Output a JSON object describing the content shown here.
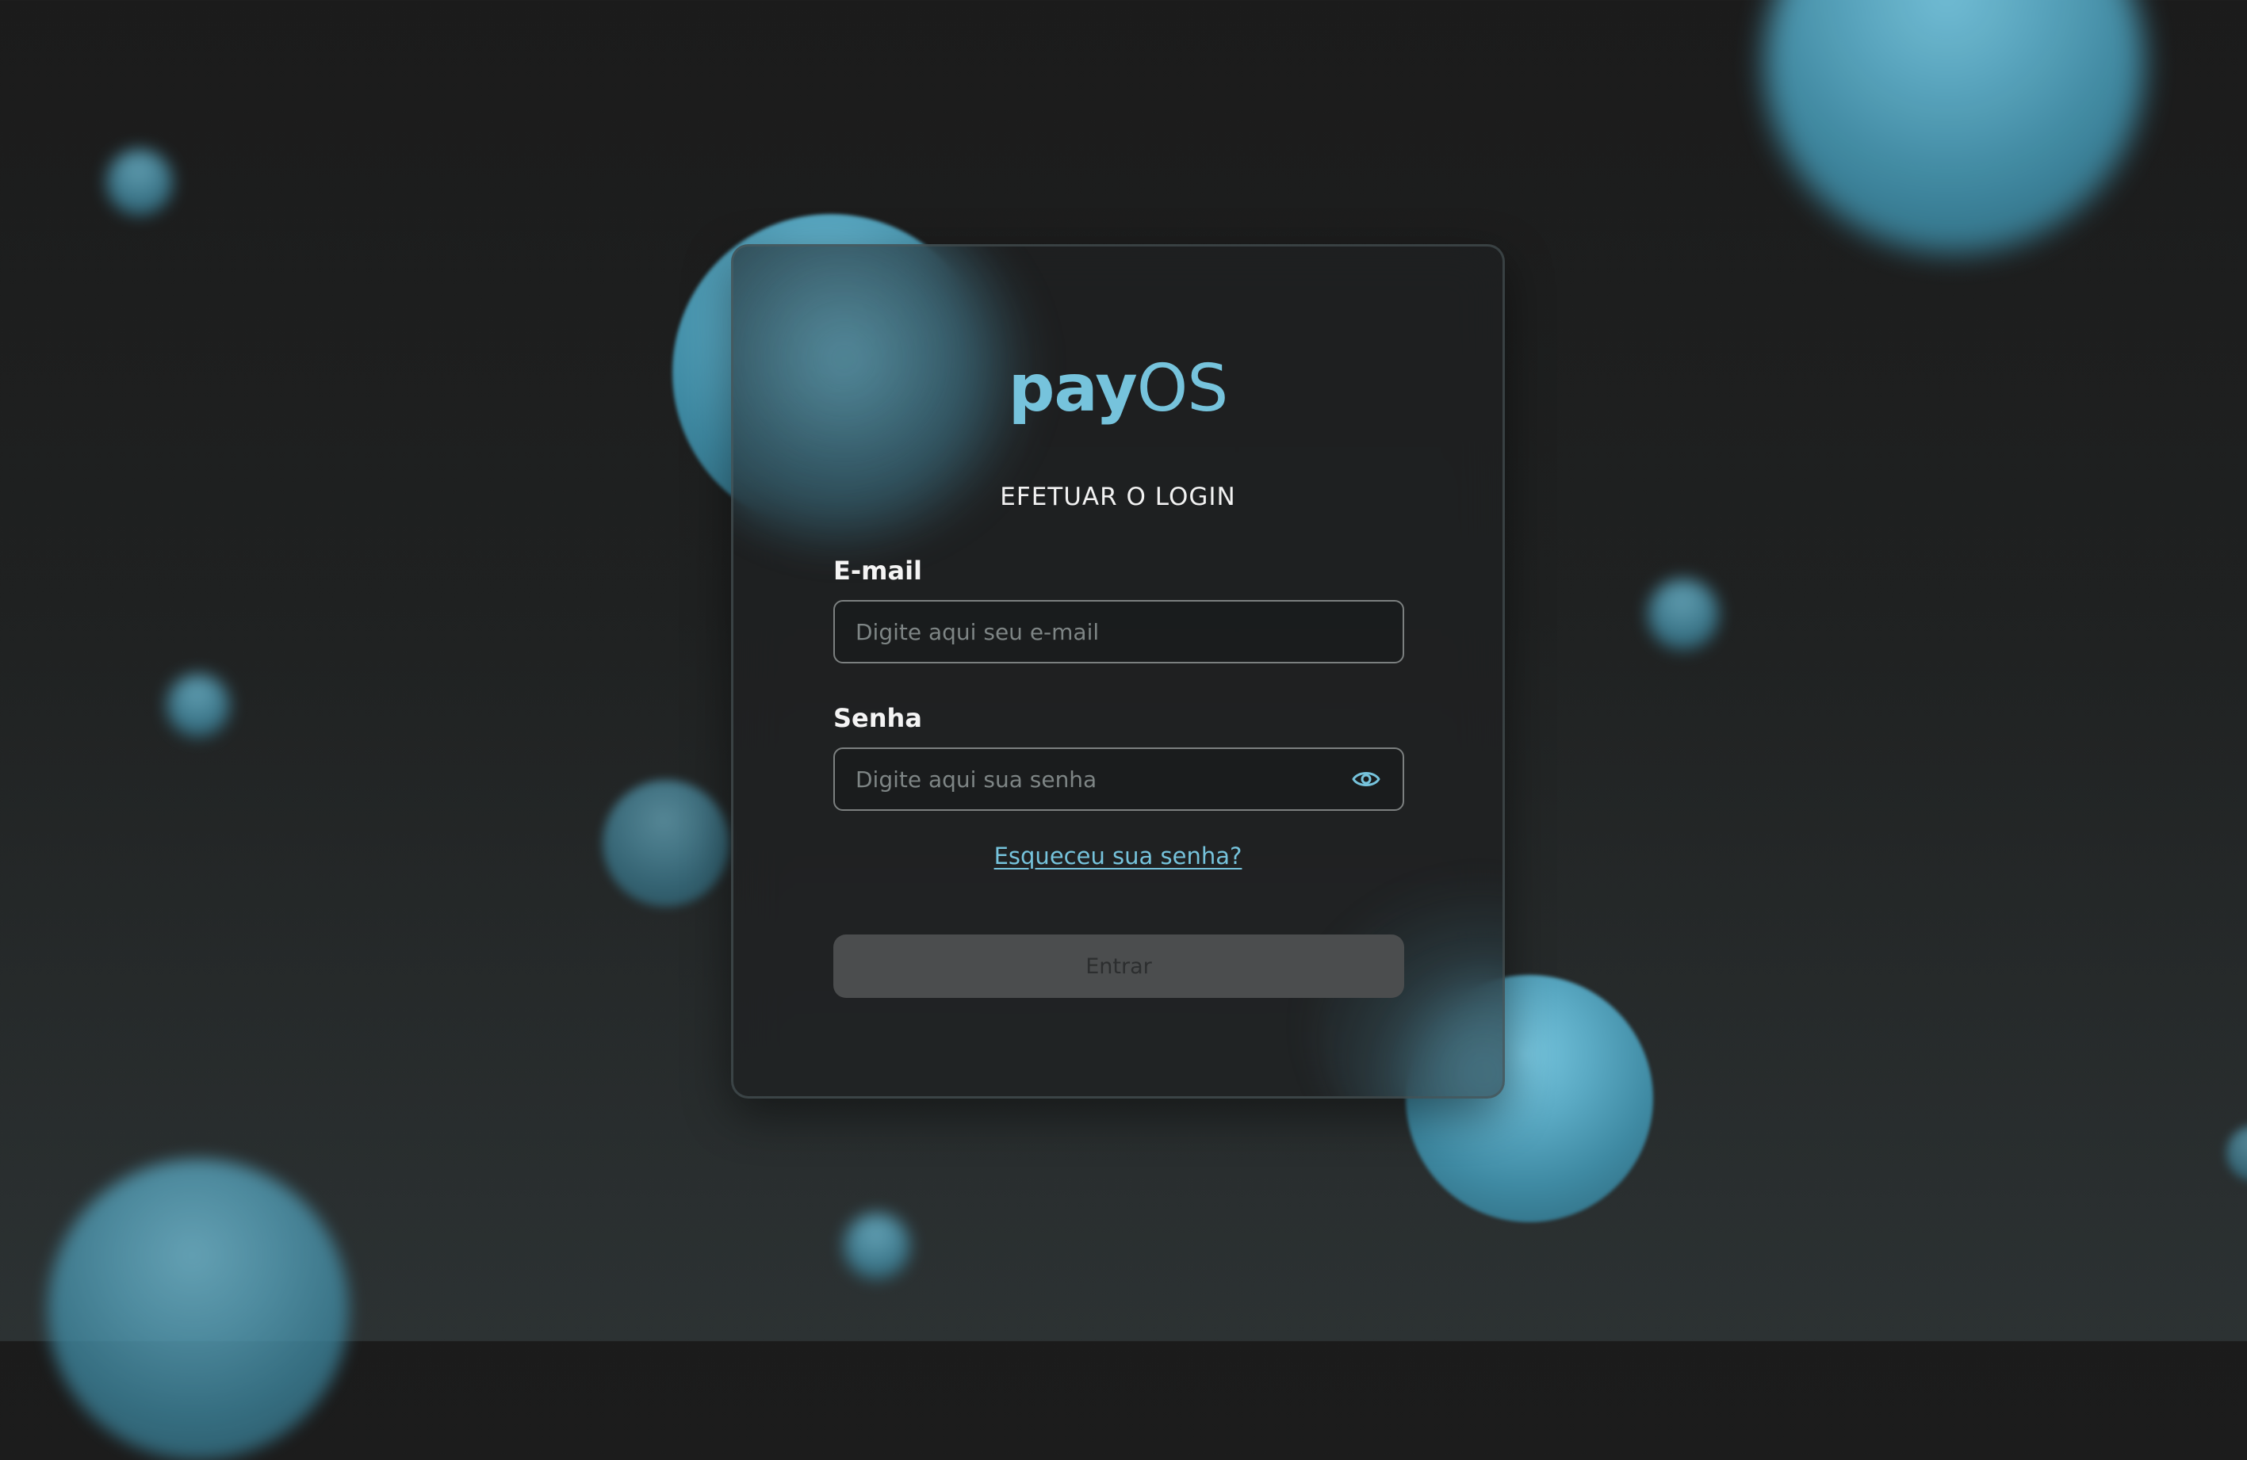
{
  "brand": {
    "logo_part1": "pay",
    "logo_part2": "OS",
    "color": "#76c3dc"
  },
  "login": {
    "title": "EFETUAR O LOGIN",
    "email": {
      "label": "E-mail",
      "placeholder": "Digite aqui seu e-mail",
      "value": ""
    },
    "password": {
      "label": "Senha",
      "placeholder": "Digite aqui sua senha",
      "value": "",
      "toggle_icon": "eye-icon"
    },
    "forgot_link": "Esqueceu sua senha?",
    "submit_label": "Entrar",
    "submit_state": "disabled"
  },
  "theme": {
    "background": "#1b1b1b",
    "accent": "#76c3dc",
    "button_disabled": "#4b4d4e"
  }
}
